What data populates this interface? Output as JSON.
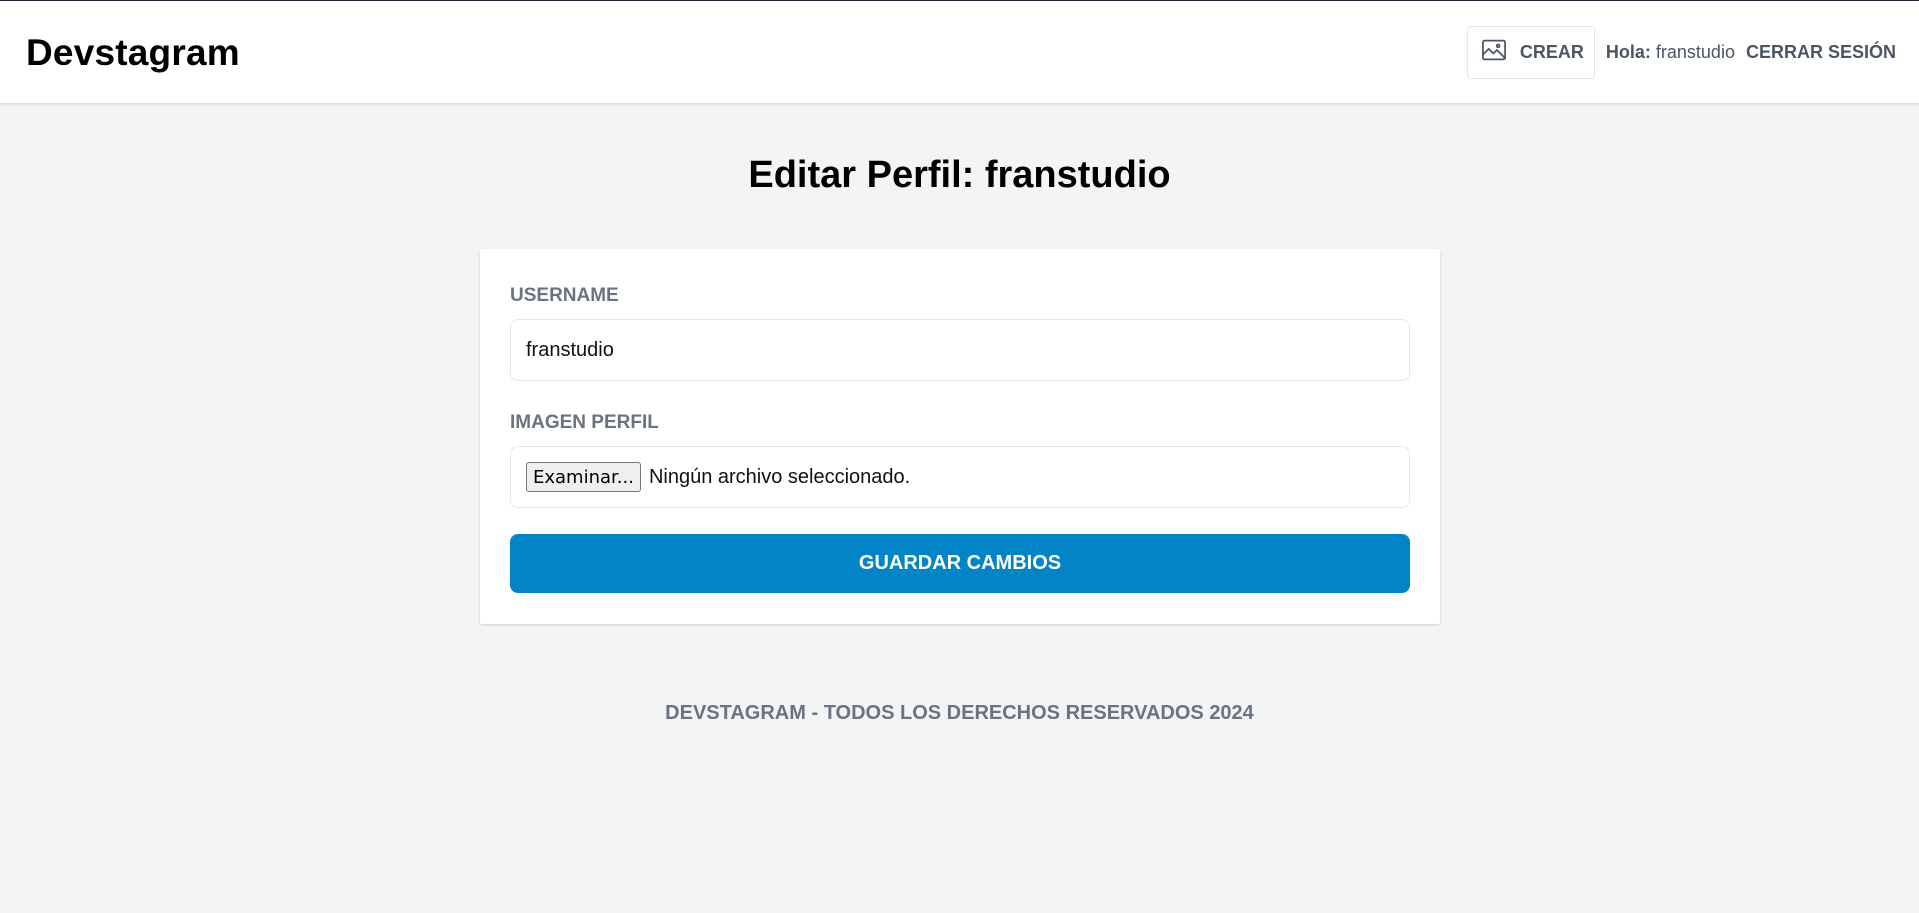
{
  "header": {
    "logo": "Devstagram",
    "create_label": "CREAR",
    "greeting_label": "Hola:",
    "username": "franstudio",
    "logout_label": "CERRAR SESIÓN",
    "create_icon": "image-icon"
  },
  "main": {
    "title": "Editar Perfil: franstudio",
    "form": {
      "username_label": "USERNAME",
      "username_value": "franstudio",
      "image_label": "IMAGEN PERFIL",
      "browse_label": "Examinar...",
      "no_file_text": "Ningún archivo seleccionado.",
      "submit_label": "GUARDAR CAMBIOS"
    }
  },
  "footer": {
    "text": "DEVSTAGRAM - TODOS LOS DERECHOS RESERVADOS 2024"
  },
  "colors": {
    "primary": "#0284c7",
    "background": "#f3f4f6",
    "label": "#6b7280"
  }
}
